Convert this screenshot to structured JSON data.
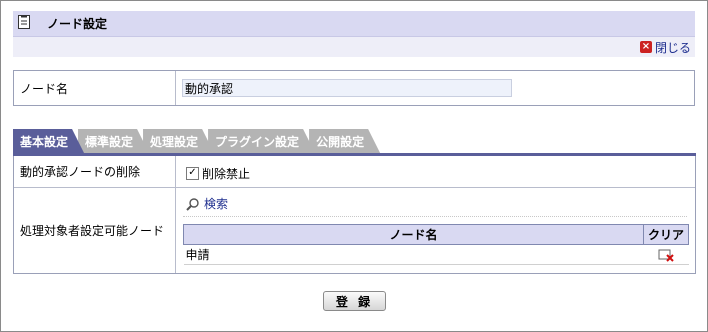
{
  "header": {
    "title": "ノード設定",
    "close_label": "閉じる"
  },
  "node_name": {
    "label": "ノード名",
    "value": "動的承認"
  },
  "tabs": [
    {
      "label": "基本設定",
      "active": true
    },
    {
      "label": "標準設定",
      "active": false
    },
    {
      "label": "処理設定",
      "active": false
    },
    {
      "label": "プラグイン設定",
      "active": false
    },
    {
      "label": "公開設定",
      "active": false
    }
  ],
  "settings": {
    "delete_row": {
      "label": "動的承認ノードの削除",
      "checkbox_label": "削除禁止",
      "checked": true
    },
    "target_row": {
      "label": "処理対象者設定可能ノード",
      "search_label": "検索",
      "table": {
        "headers": [
          "ノード名",
          "クリア"
        ],
        "rows": [
          {
            "name": "申請"
          }
        ]
      }
    }
  },
  "footer": {
    "register_label": "登 録"
  },
  "colors": {
    "header_bg": "#d9d9f2",
    "tab_active": "#5a5e9a",
    "tab_inactive": "#b4b4b4"
  }
}
